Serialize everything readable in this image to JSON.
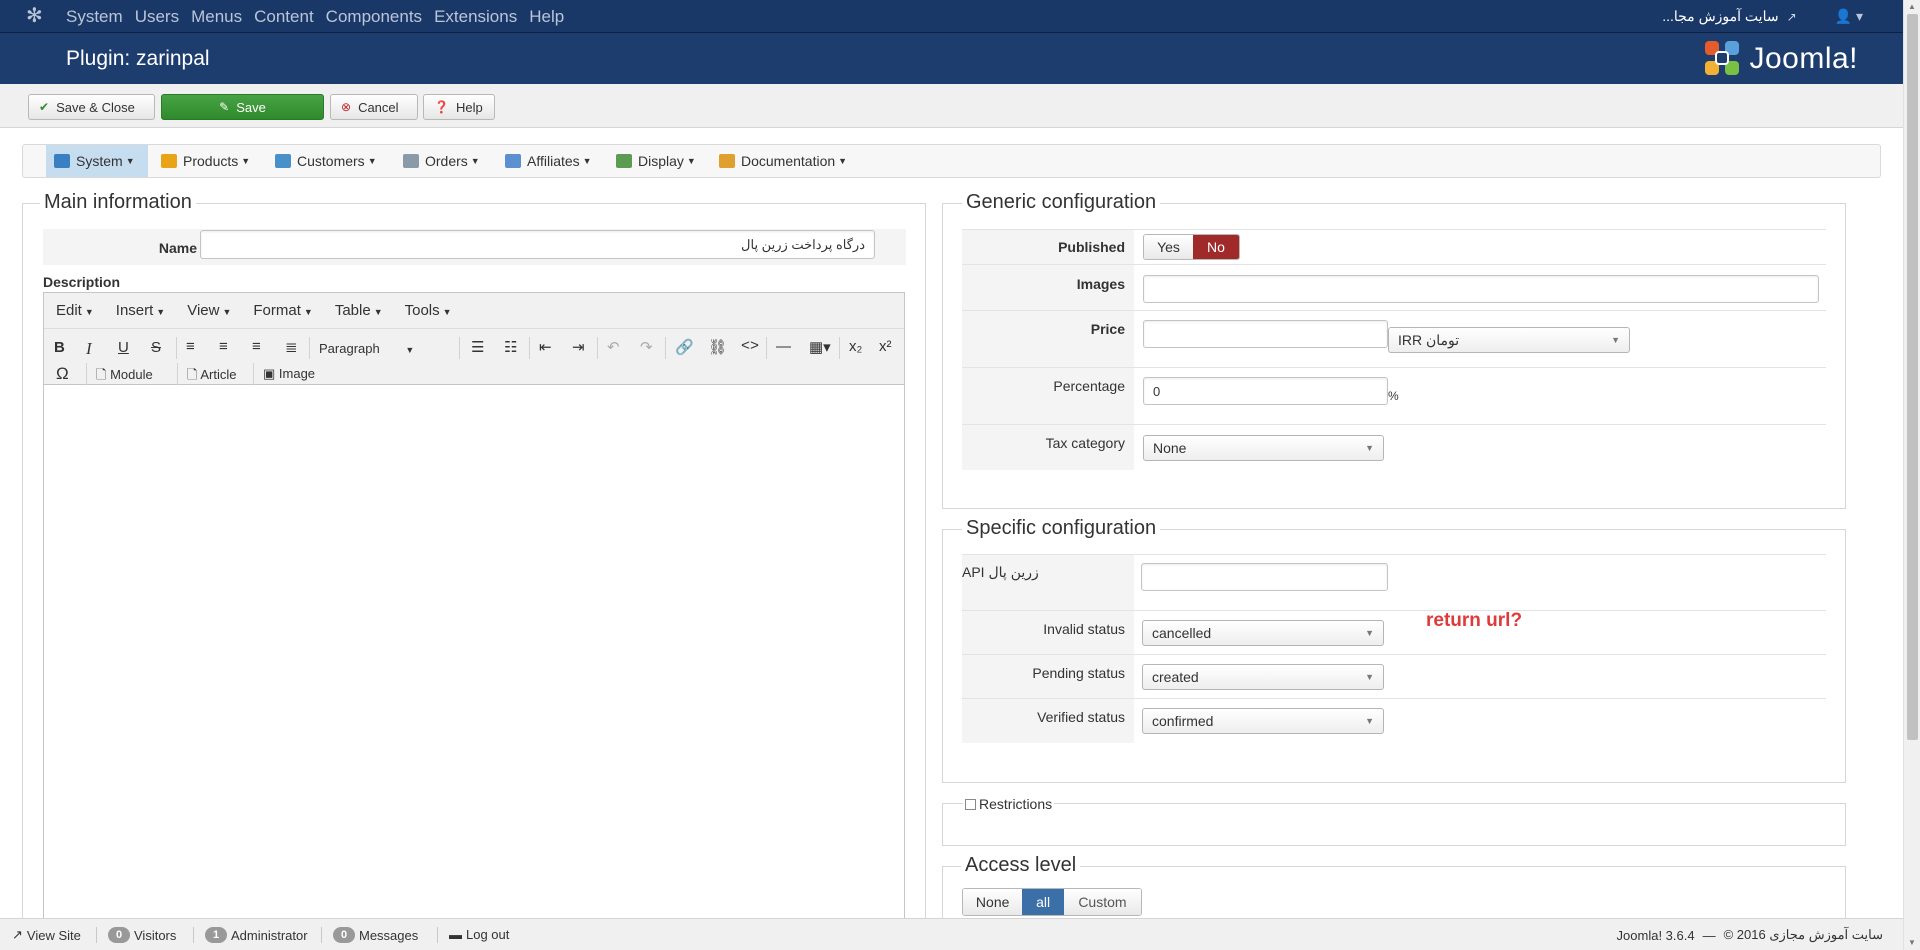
{
  "topbar": {
    "menu": [
      "System",
      "Users",
      "Menus",
      "Content",
      "Components",
      "Extensions",
      "Help"
    ],
    "site_name": "...سایت آموزش مجا"
  },
  "header": {
    "page_title": "Plugin: zarinpal",
    "brand": "Joomla!"
  },
  "toolbar": {
    "save_close": "Save & Close",
    "save": "Save",
    "cancel": "Cancel",
    "help": "Help"
  },
  "subnav": [
    {
      "label": "System",
      "icon_color": "#3a7fc1"
    },
    {
      "label": "Products",
      "icon_color": "#e8a317"
    },
    {
      "label": "Customers",
      "icon_color": "#4a90c8"
    },
    {
      "label": "Orders",
      "icon_color": "#8a9aa8"
    },
    {
      "label": "Affiliates",
      "icon_color": "#5a8fd0"
    },
    {
      "label": "Display",
      "icon_color": "#5d9b52"
    },
    {
      "label": "Documentation",
      "icon_color": "#e0a030"
    }
  ],
  "main": {
    "legend": "Main information",
    "name_label": "Name",
    "name_value": "درگاه پرداخت زرین پال",
    "description_label": "Description",
    "editor_menu": [
      "Edit",
      "Insert",
      "View",
      "Format",
      "Table",
      "Tools"
    ],
    "format_select": "Paragraph",
    "module_btn": "Module",
    "article_btn": "Article",
    "image_btn": "Image"
  },
  "generic": {
    "legend": "Generic configuration",
    "published_label": "Published",
    "yes": "Yes",
    "no": "No",
    "images_label": "Images",
    "images_value": "",
    "price_label": "Price",
    "price_value": "",
    "currency": "تومان IRR",
    "percentage_label": "Percentage",
    "percentage_value": "0",
    "percent_sign": "%",
    "tax_label": "Tax category",
    "tax_value": "None"
  },
  "specific": {
    "legend": "Specific configuration",
    "api_label": "زرین پال API",
    "api_value": "",
    "invalid_label": "Invalid status",
    "invalid_value": "cancelled",
    "pending_label": "Pending status",
    "pending_value": "created",
    "verified_label": "Verified status",
    "verified_value": "confirmed",
    "annotation": "return url?",
    "annotation_color": "#e03b3b"
  },
  "restrictions": {
    "label": "Restrictions"
  },
  "access": {
    "legend": "Access level",
    "none": "None",
    "all": "all",
    "custom": "Custom"
  },
  "status": {
    "view_site": "View Site",
    "visitors_count": "0",
    "visitors": "Visitors",
    "admin_count": "1",
    "admin": "Administrator",
    "messages_count": "0",
    "messages": "Messages",
    "logout": "Log out",
    "version": "Joomla! 3.6.4",
    "dash": "—",
    "copyright": "سایت آموزش مجازی 2016 ©"
  },
  "colors": {
    "topbar": "#1a3867",
    "header": "#1c3d6e",
    "save_green": "#3a9a36",
    "no_active": "#a02a2a",
    "all_active": "#3a6fa8"
  }
}
